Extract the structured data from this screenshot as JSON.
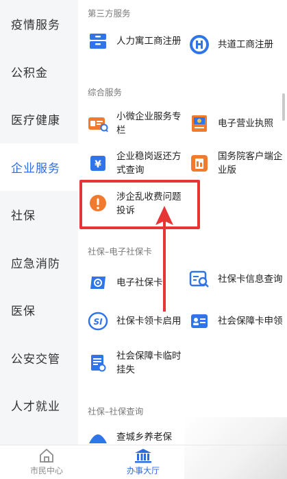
{
  "sidebar": {
    "items": [
      {
        "label": "疫情服务"
      },
      {
        "label": "公积金"
      },
      {
        "label": "医疗健康"
      },
      {
        "label": "企业服务"
      },
      {
        "label": "社保"
      },
      {
        "label": "应急消防"
      },
      {
        "label": "医保"
      },
      {
        "label": "公安交管"
      },
      {
        "label": "人才就业"
      }
    ],
    "active_index": 3
  },
  "sections": [
    {
      "title": "第三方服务",
      "items": [
        {
          "label": "人力寓工商注册",
          "icon": "cabinet-icon"
        },
        {
          "label": "共道工商注册",
          "icon": "gongdao-logo-icon"
        }
      ]
    },
    {
      "title": "综合服务",
      "items": [
        {
          "label": "小微企业服务专栏",
          "icon": "business-card-icon"
        },
        {
          "label": "电子营业执照",
          "icon": "license-icon"
        },
        {
          "label": "企业稳岗返还方式查询",
          "icon": "yuan-icon"
        },
        {
          "label": "国务院客户端企业版",
          "icon": "state-council-app-icon"
        },
        {
          "label": "涉企乱收费问题投诉",
          "icon": "exclamation-icon"
        }
      ]
    },
    {
      "title": "社保–电子社保卡",
      "items": [
        {
          "label": "电子社保卡",
          "icon": "social-card-icon"
        },
        {
          "label": "社保卡信息查询",
          "icon": "card-search-icon"
        },
        {
          "label": "社保卡领卡启用",
          "icon": "si-logo-icon"
        },
        {
          "label": "社会保障卡申领",
          "icon": "id-card-icon"
        },
        {
          "label": "社会保障卡临时挂失",
          "icon": "document-icon"
        }
      ]
    },
    {
      "title": "社保–社保查询",
      "items": [
        {
          "label": "查城乡养老保",
          "icon": "pension-icon"
        }
      ]
    }
  ],
  "tabbar": {
    "tabs": [
      {
        "label": "市民中心",
        "icon": "home-icon"
      },
      {
        "label": "办事大厅",
        "icon": "hall-icon"
      }
    ],
    "active_index": 1
  },
  "colors": {
    "accent": "#2d6ce0",
    "highlight": "#e53535",
    "icon_blue": "#2f74e8",
    "icon_orange": "#f07a2e"
  }
}
